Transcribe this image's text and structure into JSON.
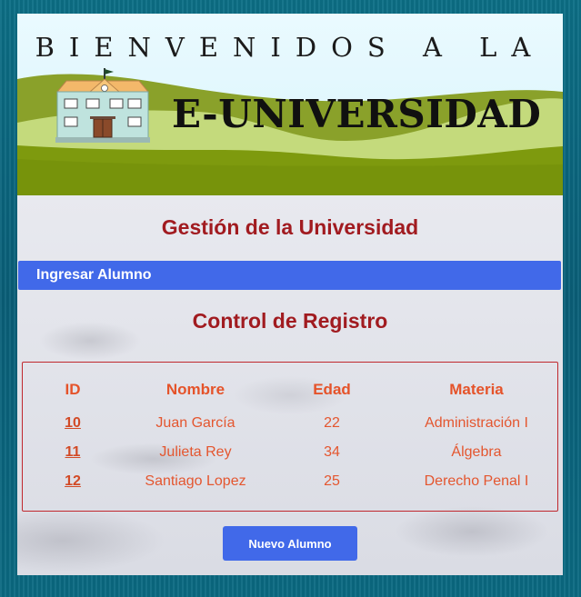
{
  "banner": {
    "welcome_text": "BIENVENIDOS A LA",
    "brand_text": "E-UNIVERSIDAD",
    "logo_icon": "school-building-icon"
  },
  "main": {
    "title": "Gestión de la Universidad"
  },
  "nav": {
    "link_label": "Ingresar Alumno"
  },
  "registry": {
    "title": "Control de Registro",
    "columns": [
      "ID",
      "Nombre",
      "Edad",
      "Materia"
    ],
    "rows": [
      {
        "id": "10",
        "nombre": "Juan García",
        "edad": "22",
        "materia": "Administración I"
      },
      {
        "id": "11",
        "nombre": "Julieta Rey",
        "edad": "34",
        "materia": "Álgebra"
      },
      {
        "id": "12",
        "nombre": "Santiago Lopez",
        "edad": "25",
        "materia": "Derecho Penal I"
      }
    ],
    "new_button_label": "Nuevo Alumno"
  },
  "colors": {
    "accent_blue": "#4169e9",
    "title_red": "#a11b20",
    "table_orange": "#e5532a",
    "hill_green": "#7f9b13"
  }
}
